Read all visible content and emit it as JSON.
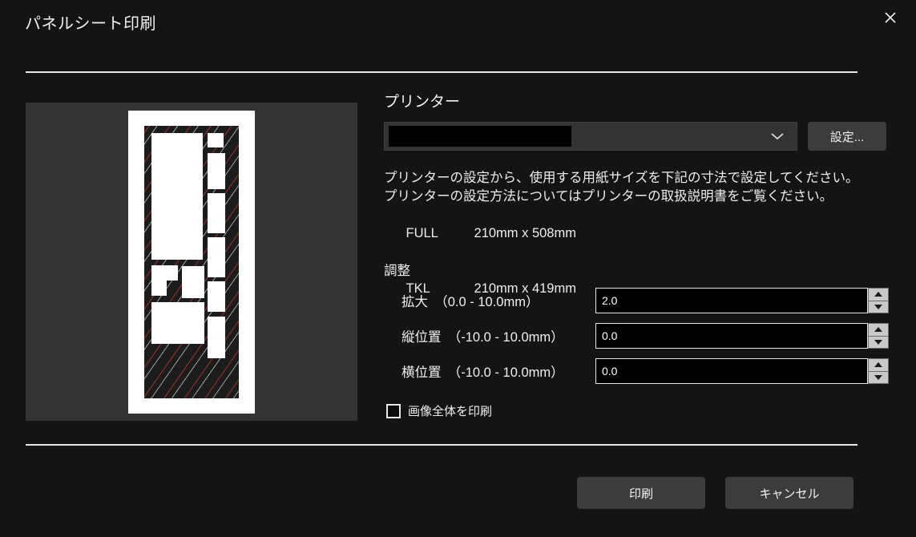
{
  "window": {
    "title": "パネルシート印刷",
    "close_icon": "close-icon"
  },
  "preview": {
    "name": "print-preview",
    "paper_color": "#ffffff",
    "panel_background": "#333333",
    "sheet_color": "#1c1c1c",
    "watermark_colors": [
      "#ebebeb",
      "#c83c2d"
    ]
  },
  "printer": {
    "section_label": "プリンター",
    "combo_value": "",
    "combo_redacted": true,
    "caret_icon": "chevron-down-icon",
    "settings_button": "設定..."
  },
  "info": {
    "line1": "プリンターの設定から、使用する用紙サイズを下記の寸法で設定してください。",
    "line2": "プリンターの設定方法についてはプリンターの取扱説明書をご覧ください。",
    "sizes": [
      {
        "name": "FULL",
        "dimension": "210mm x 508mm"
      },
      {
        "name": "TKL",
        "dimension": "210mm x 419mm"
      }
    ]
  },
  "adjust": {
    "title": "調整",
    "fields": [
      {
        "label": "拡大　（0.0 - 10.0mm）",
        "value": "2.0"
      },
      {
        "label": "縦位置　（-10.0 - 10.0mm）",
        "value": "0.0"
      },
      {
        "label": "横位置　（-10.0 - 10.0mm）",
        "value": "0.0"
      }
    ],
    "spinner_up_icon": "triangle-up-icon",
    "spinner_down_icon": "triangle-down-icon"
  },
  "options": {
    "print_whole_image_label": "画像全体を印刷",
    "print_whole_image_checked": false
  },
  "footer": {
    "print_label": "印刷",
    "cancel_label": "キャンセル"
  }
}
